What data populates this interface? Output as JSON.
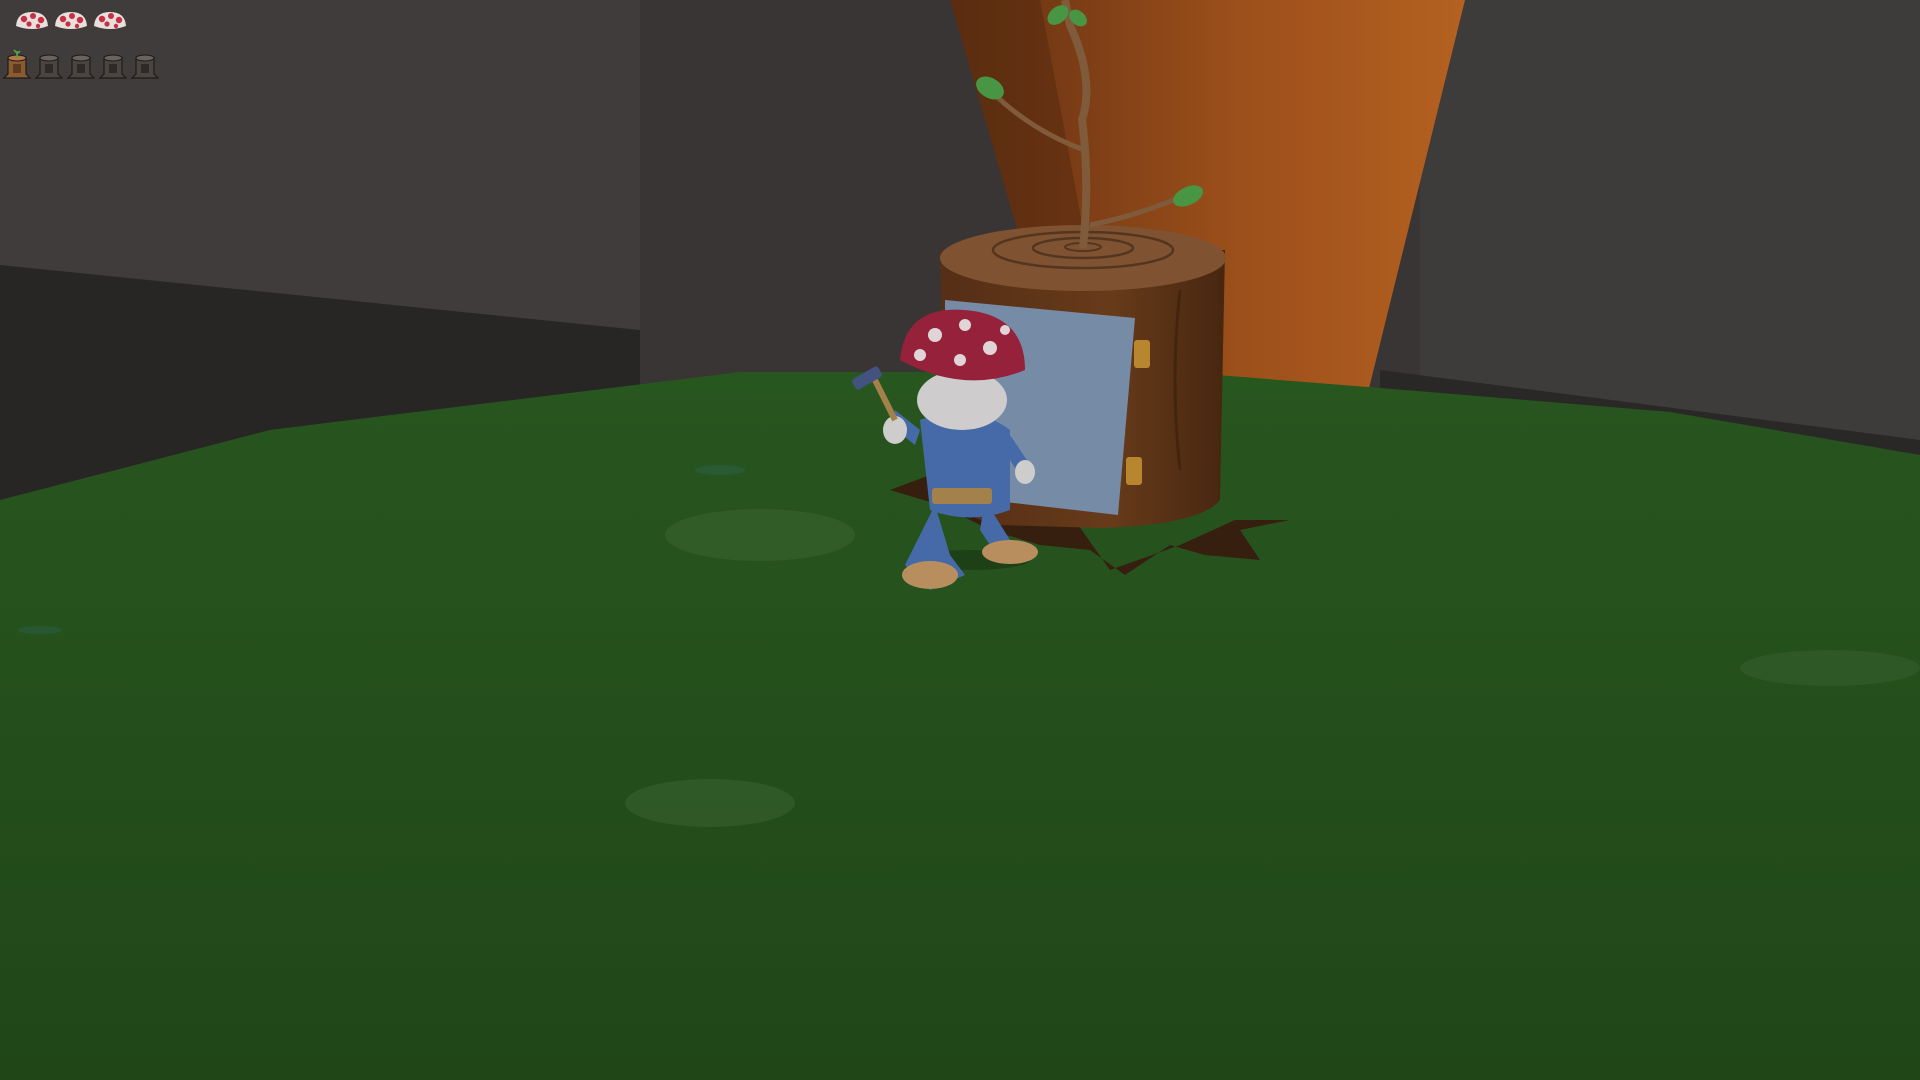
{
  "hud": {
    "lives": {
      "current": 3,
      "icon": "mushroom-cap-icon",
      "color": "#e8e0dd",
      "spot_color": "#c62f44"
    },
    "stumps": {
      "collected": 1,
      "total": 5,
      "icon": "tree-stump-icon",
      "filled_color": "#8a5a32",
      "empty_color": "#4a4442"
    }
  },
  "scene": {
    "colors": {
      "wall": "#3f3c3b",
      "wall_dark": "#2a2827",
      "grass": "#2b5a22",
      "grass_light": "#356b28",
      "pot": "#b25a1e",
      "pot_dark": "#6b3414",
      "stump": "#6b3c1c",
      "stump_top": "#8a5a36",
      "door": "#7f97b5",
      "hinge": "#c89232",
      "gnome_hat": "#a3243f",
      "gnome_suit": "#4b74b6",
      "gnome_boot": "#c89b66",
      "leaf": "#4fa34a"
    }
  }
}
